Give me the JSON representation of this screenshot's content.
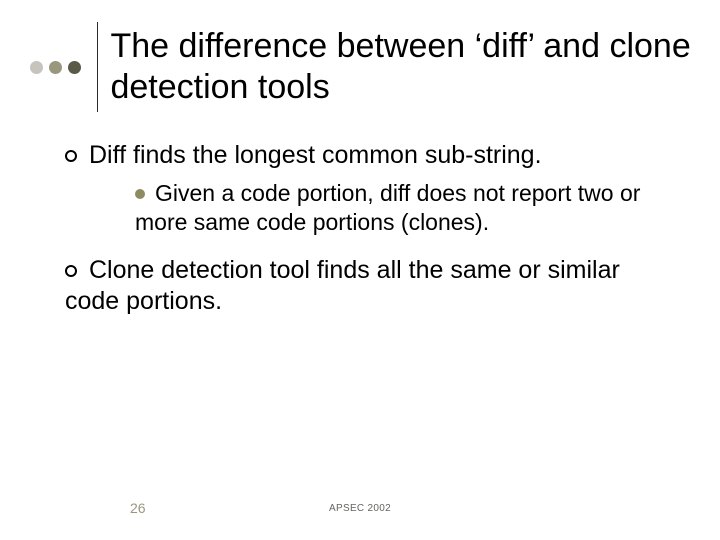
{
  "title": "The difference between ‘diff’ and clone detection tools",
  "bullets": {
    "b1": "Diff finds the longest common sub-string.",
    "b1_sub": "Given a code portion, diff does not report two or more same code portions (clones).",
    "b2": "Clone detection tool finds all the same or similar code portions."
  },
  "footer": {
    "page": "26",
    "conference": "APSEC 2002"
  }
}
